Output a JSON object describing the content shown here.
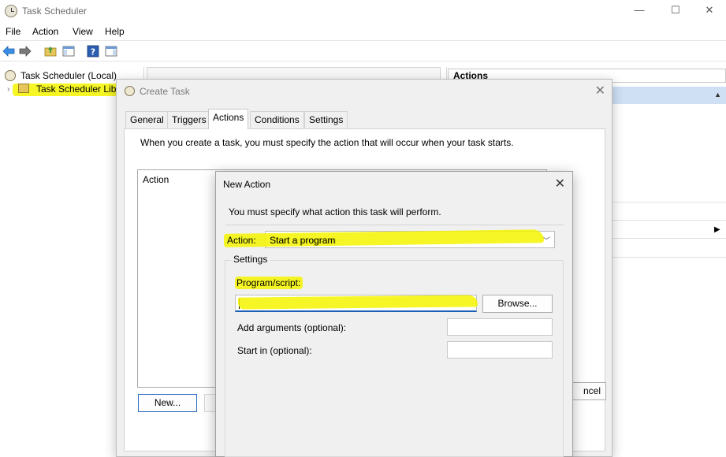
{
  "window": {
    "title": "Task Scheduler",
    "controls": [
      "—",
      "☐",
      "✕"
    ]
  },
  "menu": [
    "File",
    "Action",
    "View",
    "Help"
  ],
  "tree": {
    "root": "Task Scheduler (Local)",
    "child": "Task Scheduler Libr"
  },
  "right_panel": {
    "header": "Actions"
  },
  "create_task": {
    "title": "Create Task",
    "tabs": [
      "General",
      "Triggers",
      "Actions",
      "Conditions",
      "Settings"
    ],
    "active_tab": "Actions",
    "description": "When you create a task, you must specify the action that will occur when your task starts.",
    "list_header": "Action",
    "new_label": "New...",
    "cancel_label": "ncel"
  },
  "new_action": {
    "title": "New Action",
    "description": "You must specify what action this task will perform.",
    "action_label": "Action:",
    "action_value": "Start a program",
    "settings_label": "Settings",
    "program_label": "Program/script:",
    "program_value": "",
    "browse_label": "Browse...",
    "args_label": "Add arguments (optional):",
    "start_label": "Start in (optional):"
  },
  "colors": {
    "highlight": "#f5f500",
    "selection": "#cfe0f5",
    "focus_border": "#1b5fb6"
  }
}
